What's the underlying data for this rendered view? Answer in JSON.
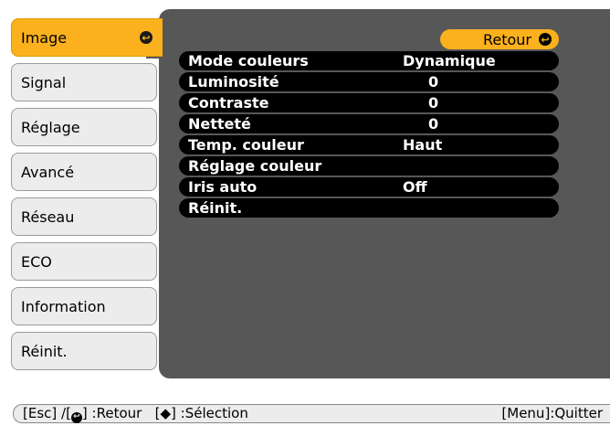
{
  "tabs": [
    {
      "label": "Image",
      "active": true
    },
    {
      "label": "Signal",
      "active": false
    },
    {
      "label": "Réglage",
      "active": false
    },
    {
      "label": "Avancé",
      "active": false
    },
    {
      "label": "Réseau",
      "active": false
    },
    {
      "label": "ECO",
      "active": false
    },
    {
      "label": "Information",
      "active": false
    },
    {
      "label": "Réinit.",
      "active": false
    }
  ],
  "back_button": {
    "label": "Retour"
  },
  "settings": [
    {
      "name": "Mode couleurs",
      "value": "Dynamique"
    },
    {
      "name": "Luminosité",
      "value": "0"
    },
    {
      "name": "Contraste",
      "value": "0"
    },
    {
      "name": "Netteté",
      "value": "0"
    },
    {
      "name": "Temp. couleur",
      "value": "Haut"
    },
    {
      "name": "Réglage couleur",
      "value": ""
    },
    {
      "name": "Iris auto",
      "value": "Off"
    },
    {
      "name": "Réinit.",
      "value": ""
    }
  ],
  "footer": {
    "esc_prefix": "[Esc] /[",
    "retour_suffix": "] :Retour",
    "select_prefix": "[",
    "select_arrow": "◆",
    "select_suffix": "] :Sélection",
    "quit": "[Menu]:Quitter"
  },
  "colors": {
    "accent": "#fbb11d",
    "panel": "#575757",
    "row": "#000000",
    "tab": "#ececec"
  }
}
